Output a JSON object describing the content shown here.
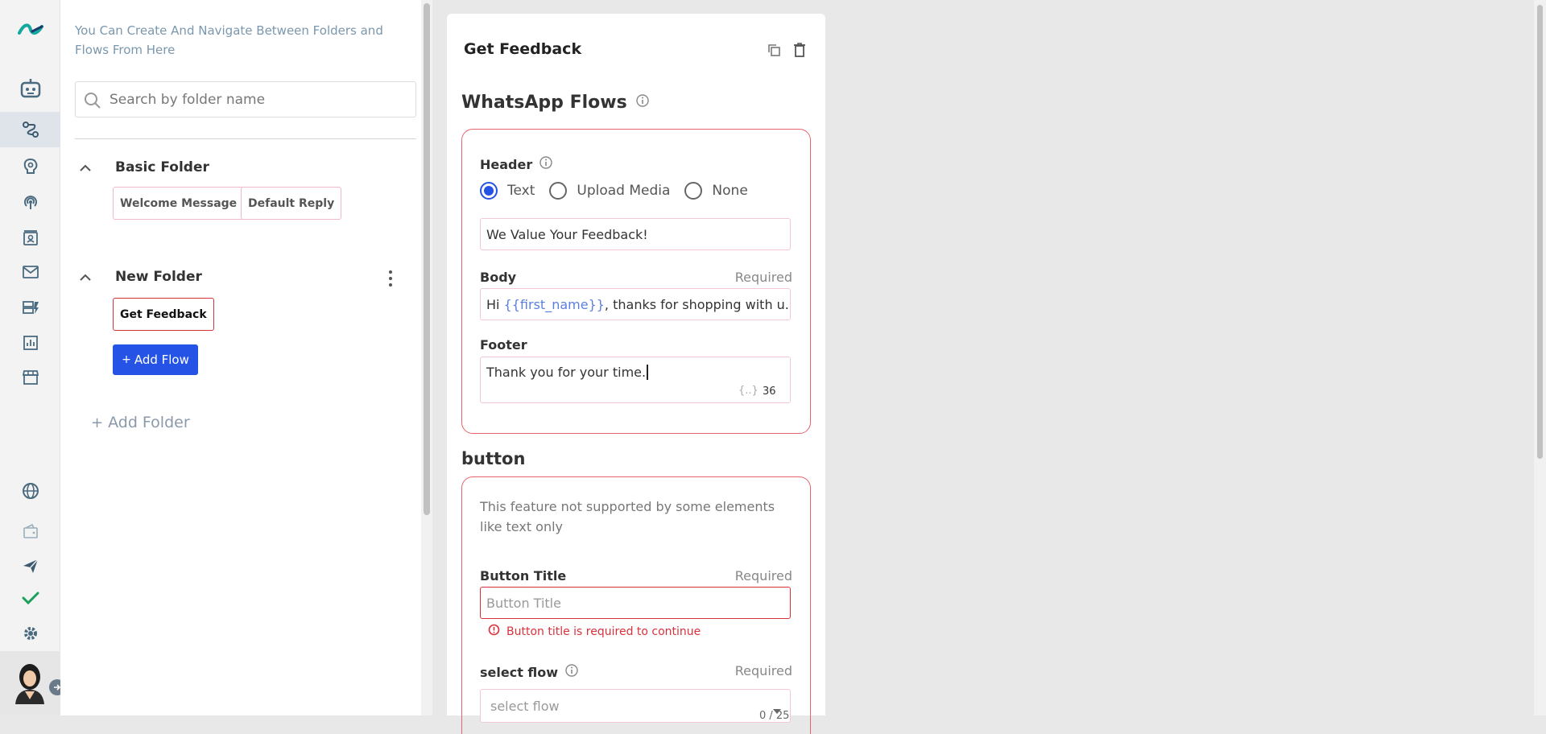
{
  "colors": {
    "accent": "#2553e6",
    "error": "#d9313a",
    "error_border": "#e8646a",
    "muted": "#7a97ad"
  },
  "rail": {
    "items": [
      {
        "icon": "bot-icon"
      },
      {
        "icon": "flows-icon",
        "active": true
      },
      {
        "icon": "brain-icon"
      },
      {
        "icon": "broadcast-icon"
      },
      {
        "icon": "contacts-icon"
      },
      {
        "icon": "mail-icon"
      },
      {
        "icon": "campaign-icon"
      },
      {
        "icon": "analytics-icon"
      },
      {
        "icon": "store-icon"
      },
      {
        "icon": "globe-icon"
      },
      {
        "icon": "wallet-icon"
      },
      {
        "icon": "send-icon"
      },
      {
        "icon": "check-icon"
      },
      {
        "icon": "settings-icon"
      }
    ]
  },
  "folders": {
    "hint": "You Can Create And Navigate Between Folders and Flows From Here",
    "search_placeholder": "Search by folder name",
    "list": [
      {
        "name": "Basic Folder",
        "flows": [
          "Welcome Message",
          "Default Reply"
        ]
      },
      {
        "name": "New Folder",
        "flows": [
          "Get Feedback"
        ]
      }
    ],
    "add_flow": "Add Flow",
    "add_folder": "Add Folder"
  },
  "editor": {
    "title": "Get Feedback",
    "whatsapp_section": "WhatsApp Flows",
    "header_label": "Header",
    "header_options": [
      "Text",
      "Upload Media",
      "None"
    ],
    "header_selected": "Text",
    "header_value": "We Value Your Feedback!",
    "body_label": "Body",
    "required": "Required",
    "body_prefix": "Hi ",
    "body_token": "{{first_name}}",
    "body_suffix": ", thanks for shopping with u...",
    "footer_label": "Footer",
    "footer_value": "Thank you for your time.",
    "footer_var_hint": "{..}",
    "footer_count": "36",
    "button_section": "button",
    "button_hint": "This feature not supported by some elements like text only",
    "button_title_label": "Button Title",
    "button_title_placeholder": "Button Title",
    "button_title_error": "Button title is required to continue",
    "select_flow_label": "select flow",
    "select_flow_placeholder": "select flow",
    "select_flow_count": "0 / 25"
  }
}
